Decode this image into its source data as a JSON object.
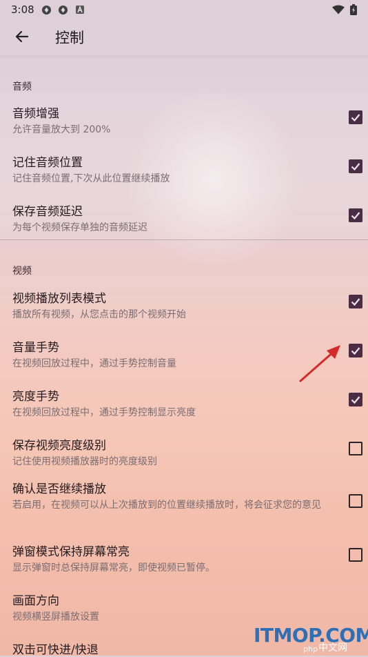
{
  "status_bar": {
    "time": "3:08"
  },
  "app_bar": {
    "title": "控制"
  },
  "sections": [
    {
      "header": "音频",
      "items": [
        {
          "title": "音频增强",
          "subtitle": "允许音量放大到 200%",
          "checked": true
        },
        {
          "title": "记住音频位置",
          "subtitle": "记住音频位置,下次从此位置继续播放",
          "checked": true
        },
        {
          "title": "保存音频延迟",
          "subtitle": "为每个视频保存单独的音频延迟",
          "checked": true
        }
      ]
    },
    {
      "header": "视频",
      "items": [
        {
          "title": "视频播放列表模式",
          "subtitle": "播放所有视频，从您点击的那个视频开始",
          "checked": true
        },
        {
          "title": "音量手势",
          "subtitle": "在视频回放过程中，通过手势控制音量",
          "checked": true
        },
        {
          "title": "亮度手势",
          "subtitle": "在视频回放过程中，通过手势控制显示亮度",
          "checked": true
        },
        {
          "title": "保存视频亮度级别",
          "subtitle": "记住使用视频播放器时的亮度级别",
          "checked": false
        },
        {
          "title": "确认是否继续播放",
          "subtitle": "若启用，在视频可以从上次播放到的位置继续播放时，将会征求您的意见",
          "checked": false
        },
        {
          "title": "弹窗模式保持屏幕常亮",
          "subtitle": "显示弹窗时总保持屏幕常亮，即使视频已暂停。",
          "checked": false
        },
        {
          "title": "画面方向",
          "subtitle": "视频横竖屏播放设置"
        },
        {
          "title": "双击可快进/快退"
        }
      ]
    }
  ],
  "watermark": {
    "main": "ITMOP.COM",
    "php": "php",
    "zh": "中文网"
  },
  "colors": {
    "checkbox_on": "#4b2c45",
    "annotation_arrow": "#d42a2a"
  }
}
